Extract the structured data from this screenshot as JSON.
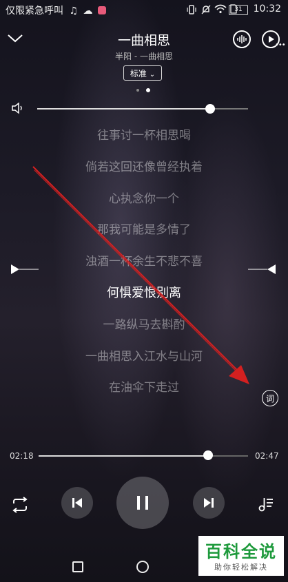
{
  "status_bar": {
    "left_text": "仅限紧急呼叫",
    "battery": "31",
    "time": "10:32"
  },
  "header": {
    "title": "一曲相思",
    "subtitle": "半阳 - 一曲相思",
    "quality": "标准",
    "page_dots": 2,
    "active_dot": 2
  },
  "volume": {
    "level": 0.82
  },
  "lyrics": {
    "lines": [
      "往事讨一杯相思喝",
      "倘若这回还像曾经执着",
      "心执念你一个",
      "那我可能是多情了",
      "浊酒一杯余生不悲不喜",
      "何惧爱恨别离",
      "一路纵马去斟酌",
      "一曲相思入江水与山河",
      "在油伞下走过"
    ],
    "active_index": 5,
    "lyric_button": "词"
  },
  "progress": {
    "current": "02:18",
    "total": "02:47",
    "fraction": 0.81
  },
  "controls": {
    "icons": [
      "repeat-icon",
      "previous-icon",
      "pause-icon",
      "next-icon",
      "playlist-icon"
    ]
  },
  "watermark": {
    "title": "百科全说",
    "subtitle": "助你轻松解决"
  },
  "colors": {
    "watermark_green": "#1e9a3c",
    "annotation_red": "#d42020"
  }
}
